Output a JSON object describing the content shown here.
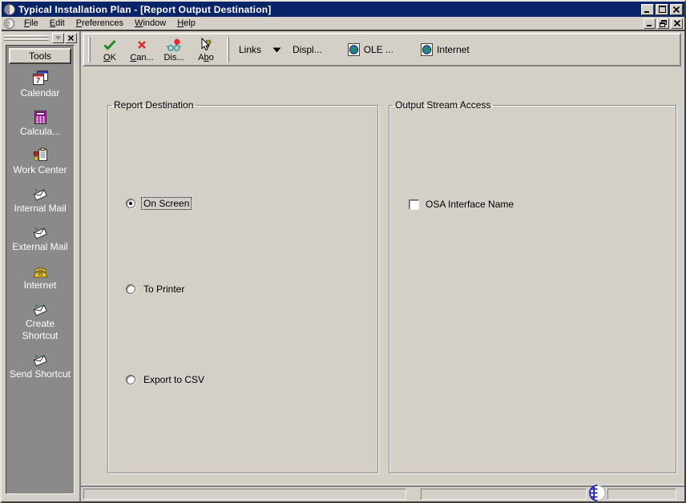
{
  "window": {
    "title": "Typical Installation Plan - [Report Output Destination]",
    "icons": {
      "app": "globe-sphere-icon",
      "statusbar": "globe-icon"
    }
  },
  "menu": {
    "items": [
      {
        "text": "File",
        "u": 0
      },
      {
        "text": "Edit",
        "u": 0
      },
      {
        "text": "Preferences",
        "u": 0
      },
      {
        "text": "Window",
        "u": 0
      },
      {
        "text": "Help",
        "u": 0
      }
    ]
  },
  "toolbar": {
    "buttons": [
      {
        "text": "OK",
        "u": 0,
        "icon": "check-icon"
      },
      {
        "text": "Can...",
        "u": 0,
        "icon": "cancel-icon"
      },
      {
        "text": "Dis...",
        "u": -1,
        "icon": "find-icon"
      },
      {
        "text": "Abo",
        "u": 1,
        "icon": "help-icon"
      }
    ],
    "links_label": "Links",
    "display_label": "Displ...",
    "ole_label": "OLE ...",
    "internet_label": "Internet"
  },
  "sidebar": {
    "header": "Tools",
    "items": [
      {
        "label": "Calendar",
        "icon": "calendar-icon"
      },
      {
        "label": "Calcula...",
        "icon": "calculator-icon"
      },
      {
        "label": "Work Center",
        "icon": "work-center-icon"
      },
      {
        "label": "Internal Mail",
        "icon": "mail-icon"
      },
      {
        "label": "External Mail",
        "icon": "mail-icon"
      },
      {
        "label": "Internet",
        "icon": "phone-icon"
      },
      {
        "label": "Create Shortcut",
        "icon": "mail-icon"
      },
      {
        "label": "Send Shortcut",
        "icon": "mail-icon"
      }
    ]
  },
  "main": {
    "report_destination": {
      "title": "Report Destination",
      "options": [
        {
          "label": "On Screen",
          "selected": true,
          "focused": true
        },
        {
          "label": "To Printer",
          "selected": false,
          "focused": false
        },
        {
          "label": "Export to CSV",
          "selected": false,
          "focused": false
        }
      ]
    },
    "output_stream_access": {
      "title": "Output Stream Access",
      "checkbox": {
        "label": "OSA Interface Name",
        "checked": false
      }
    }
  },
  "colors": {
    "titlebar": "#0a246a",
    "window_face": "#d4d0c8",
    "exitbar_gray": "#8a8a8a",
    "check_green": "#1f8a1f",
    "cancel_red": "#d42a2a"
  }
}
